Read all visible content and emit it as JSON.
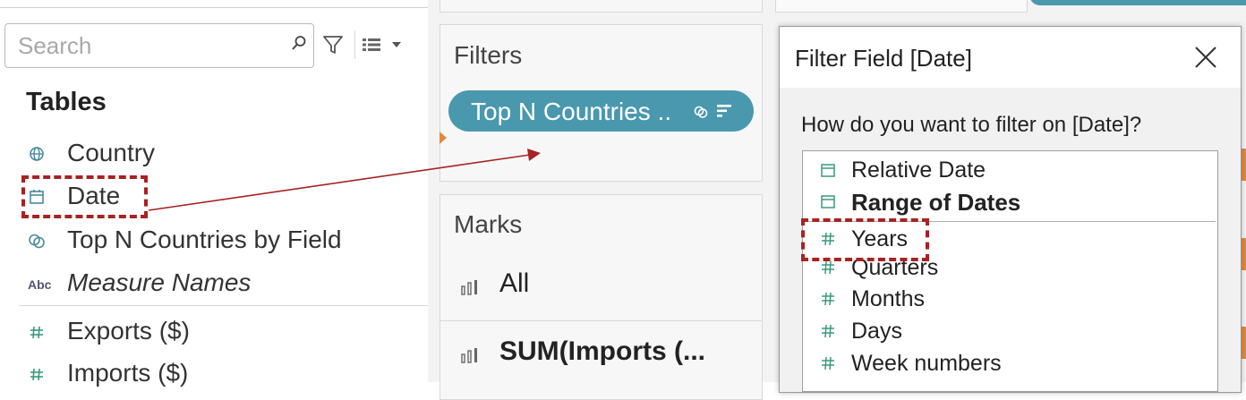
{
  "data_pane": {
    "search": {
      "placeholder": "Search",
      "value": ""
    },
    "tables_heading": "Tables",
    "fields": [
      {
        "label": "Country",
        "icon": "globe-icon"
      },
      {
        "label": "Date",
        "icon": "calendar-icon"
      },
      {
        "label": "Top N Countries by Field",
        "icon": "set-icon"
      },
      {
        "label": "Measure Names",
        "icon": "abc-icon",
        "badge": "Abc"
      },
      {
        "label": "Exports ($)",
        "icon": "number-icon"
      },
      {
        "label": "Imports ($)",
        "icon": "number-icon"
      }
    ]
  },
  "shelves": {
    "filters_title": "Filters",
    "filter_pill": "Top N Countries ..",
    "marks_title": "Marks",
    "marks": [
      {
        "label": "All",
        "bold": false
      },
      {
        "label": "SUM(Imports (...",
        "bold": true
      }
    ]
  },
  "dialog": {
    "title": "Filter Field [Date]",
    "question": "How do you want to filter on [Date]?",
    "options": [
      {
        "label": "Relative Date",
        "icon": "calendar-icon",
        "bold": false
      },
      {
        "label": "Range of Dates",
        "icon": "calendar-icon",
        "bold": true
      },
      {
        "label": "Years",
        "icon": "number-icon",
        "bold": false
      },
      {
        "label": "Quarters",
        "icon": "number-icon",
        "bold": false
      },
      {
        "label": "Months",
        "icon": "number-icon",
        "bold": false
      },
      {
        "label": "Days",
        "icon": "number-icon",
        "bold": false
      },
      {
        "label": "Week numbers",
        "icon": "number-icon",
        "bold": false
      }
    ]
  },
  "colors": {
    "pill": "#4a98ae",
    "highlight": "#a82222",
    "icon_green": "#3a9a7a",
    "icon_teal": "#4a8aa0",
    "accent_orange": "#e08a3e"
  }
}
